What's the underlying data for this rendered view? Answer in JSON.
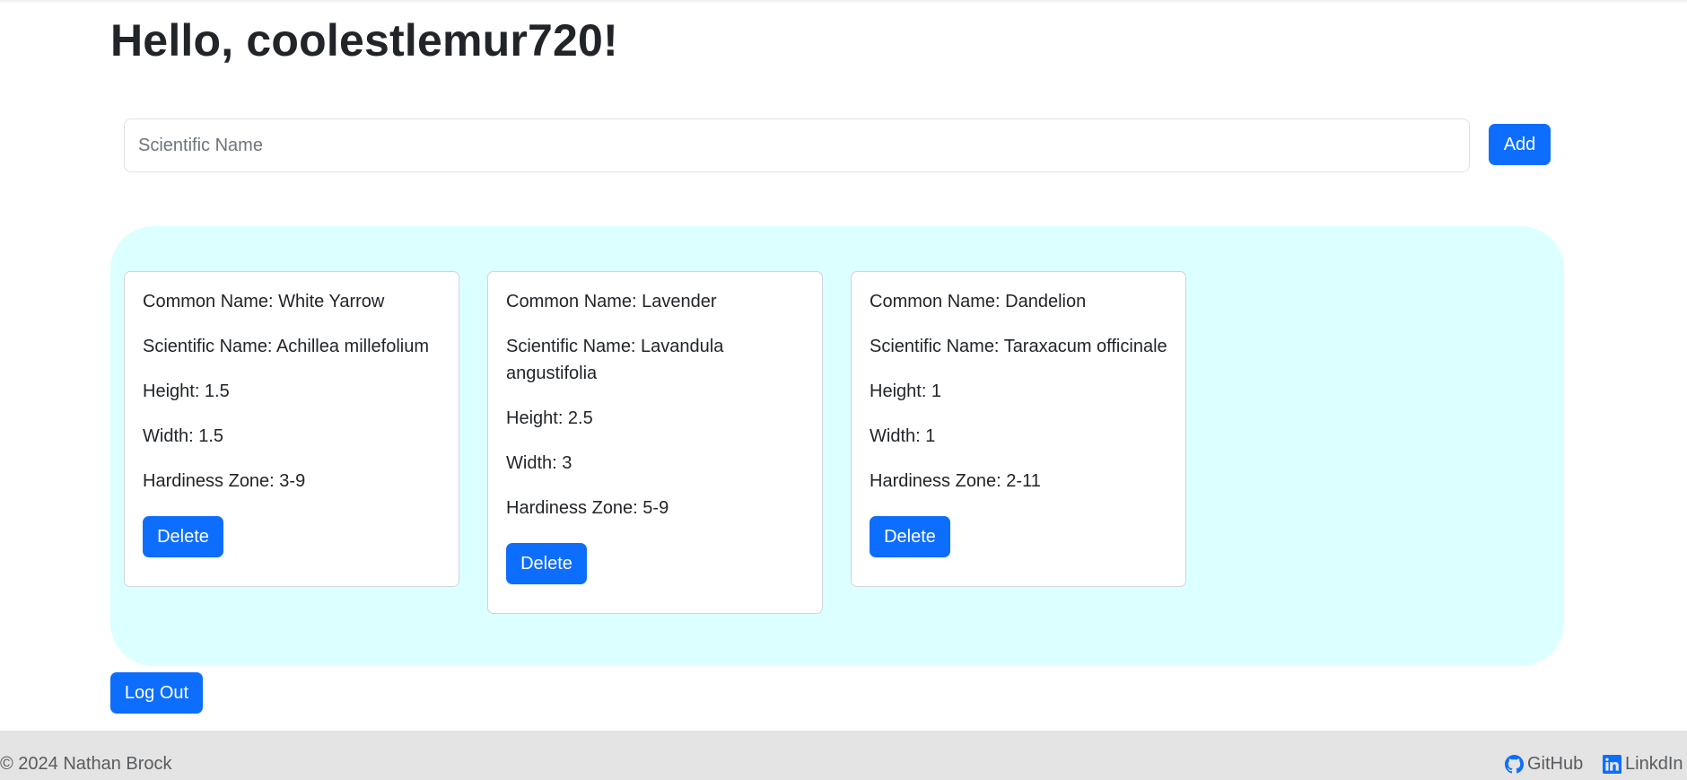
{
  "header": {
    "greeting": "Hello, coolestlemur720!"
  },
  "search": {
    "placeholder": "Scientific Name",
    "value": "",
    "add_label": "Add"
  },
  "plants": [
    {
      "common_name": "Common Name: White Yarrow",
      "scientific_name": "Scientific Name: Achillea millefolium",
      "height": "Height: 1.5",
      "width": "Width: 1.5",
      "hardiness_zone": "Hardiness Zone: 3-9",
      "delete_label": "Delete"
    },
    {
      "common_name": "Common Name: Lavender",
      "scientific_name": "Scientific Name: Lavandula angustifolia",
      "height": "Height: 2.5",
      "width": "Width: 3",
      "hardiness_zone": "Hardiness Zone: 5-9",
      "delete_label": "Delete"
    },
    {
      "common_name": "Common Name: Dandelion",
      "scientific_name": "Scientific Name: Taraxacum officinale",
      "height": "Height: 1",
      "width": "Width: 1",
      "hardiness_zone": "Hardiness Zone: 2-11",
      "delete_label": "Delete"
    }
  ],
  "actions": {
    "logout_label": "Log Out"
  },
  "footer": {
    "copyright": "© 2024 Nathan Brock",
    "github_label": "GitHub",
    "linkedin_label": "LinkdIn",
    "github_icon": "github-icon",
    "linkedin_icon": "linkedin-icon"
  },
  "colors": {
    "primary": "#0d6efd",
    "garden_background": "#dcffff",
    "footer_background": "#e4e4e4"
  }
}
